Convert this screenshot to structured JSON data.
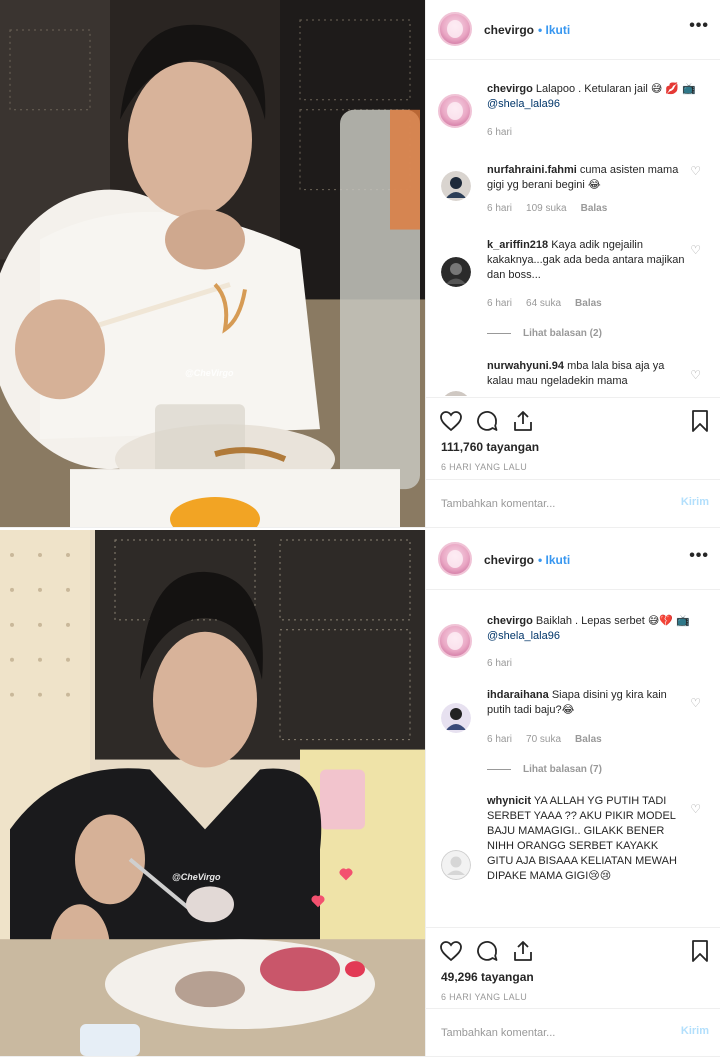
{
  "posts": [
    {
      "watermark": "@CheVirgo",
      "header": {
        "username": "chevirgo",
        "separator": "•",
        "follow": "Ikuti",
        "more": "•••"
      },
      "comments": [
        {
          "user": "chevirgo",
          "text": "Lalapoo . Ketularan jail 😅 💋 📺 ",
          "mention": "@shela_lala96",
          "time": "6 hari"
        },
        {
          "user": "nurfahraini.fahmi",
          "text": "cuma asisten mama gigi yg berani begini 😂",
          "time": "6 hari",
          "likes": "109 suka",
          "reply": "Balas"
        },
        {
          "user": "k_ariffin218",
          "text": "Kaya adik ngejailin kakaknya...gak ada beda antara majikan dan boss...",
          "time": "6 hari",
          "likes": "64 suka",
          "reply": "Balas",
          "view_replies": "Lihat balasan (2)"
        },
        {
          "user": "nurwahyuni.94",
          "text": "mba lala bisa aja ya kalau mau ngeladekin mama"
        }
      ],
      "views": "111,760 tayangan",
      "date": "6 HARI YANG LALU",
      "add_comment_placeholder": "Tambahkan komentar...",
      "post_label": "Kirim"
    },
    {
      "watermark": "@CheVirgo",
      "header": {
        "username": "chevirgo",
        "separator": "•",
        "follow": "Ikuti",
        "more": "•••"
      },
      "comments": [
        {
          "user": "chevirgo",
          "text": "Baiklah . Lepas serbet 😅💔 📺 ",
          "mention": "@shela_lala96",
          "time": "6 hari"
        },
        {
          "user": "ihdaraihana",
          "text": "Siapa disini yg kira kain putih tadi baju?😂",
          "time": "6 hari",
          "likes": "70 suka",
          "reply": "Balas",
          "view_replies": "Lihat balasan (7)"
        },
        {
          "user": "whynicit",
          "text": "YA ALLAH YG PUTIH TADI SERBET YAAA ?? AKU PIKIR MODEL BAJU MAMAGIGI.. GILAKK BENER NIHH ORANGG SERBET KAYAKK GITU AJA BISAAA KELIATAN MEWAH DIPAKE MAMA GIGI😢😢"
        }
      ],
      "views": "49,296 tayangan",
      "date": "6 HARI YANG LALU",
      "add_comment_placeholder": "Tambahkan komentar...",
      "post_label": "Kirim"
    }
  ],
  "icons": [
    "heart-icon",
    "comment-icon",
    "share-icon",
    "bookmark-icon",
    "more-icon"
  ],
  "colors": {
    "link": "#3897f0",
    "muted": "#999999",
    "text": "#262626",
    "post_disabled": "#b2dffc",
    "border": "#efefef"
  }
}
